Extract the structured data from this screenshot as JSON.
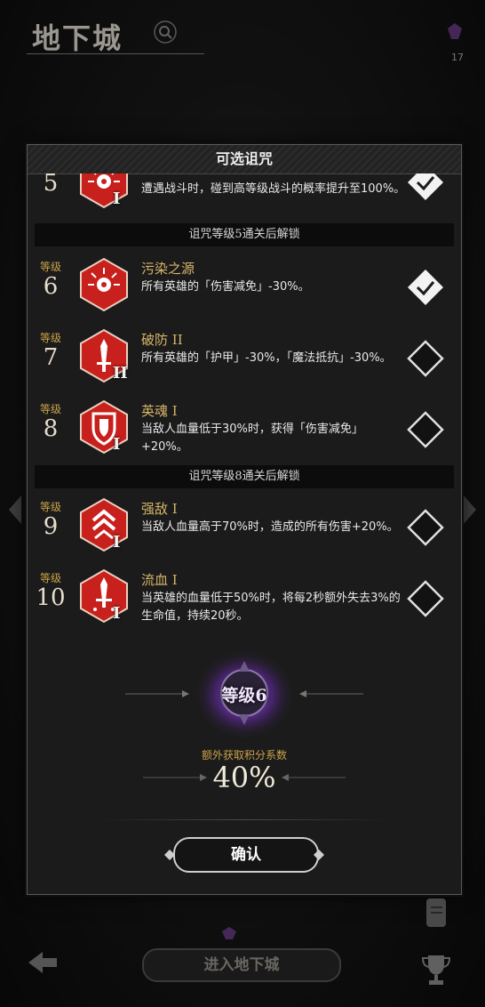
{
  "header": {
    "title": "地下城",
    "top_right_count": "17"
  },
  "panel": {
    "title": "可选诅咒",
    "level_word": "等级",
    "curses": [
      {
        "level": "5",
        "roman": "I",
        "name": "",
        "description": "遭遇战斗时，碰到高等级战斗的概率提升至100%。",
        "checked": true,
        "icon": "eye-burst-icon"
      },
      {
        "level": "6",
        "roman": "",
        "name": "污染之源",
        "description": "所有英雄的「伤害减免」-30%。",
        "checked": true,
        "icon": "eye-burst-icon"
      },
      {
        "level": "7",
        "roman": "II",
        "name": "破防 II",
        "description": "所有英雄的「护甲」-30%，「魔法抵抗」-30%。",
        "checked": false,
        "icon": "broken-sword-icon"
      },
      {
        "level": "8",
        "roman": "I",
        "name": "英魂 I",
        "description": "当敌人血量低于30%时，获得「伤害减免」+20%。",
        "checked": false,
        "icon": "shield-icon"
      },
      {
        "level": "9",
        "roman": "I",
        "name": "强敌 I",
        "description": "当敌人血量高于70%时，造成的所有伤害+20%。",
        "checked": false,
        "icon": "chevron-rank-icon"
      },
      {
        "level": "10",
        "roman": "I",
        "name": "流血 I",
        "description": "当英雄的血量低于50%时，将每2秒额外失去3%的生命值，持续20秒。",
        "checked": false,
        "icon": "bleeding-sword-icon"
      }
    ],
    "unlock_after_5": "诅咒等级5通关后解锁",
    "unlock_after_8": "诅咒等级8通关后解锁",
    "current_level": "等级6",
    "bonus_label": "额外获取积分系数",
    "bonus_value": "40%",
    "confirm_label": "确认"
  },
  "footer": {
    "enter_label": "进入地下城"
  },
  "colors": {
    "badge_red": "#c8201c",
    "gold": "#c9a34a",
    "orb_purple": "#7b3fb0"
  }
}
